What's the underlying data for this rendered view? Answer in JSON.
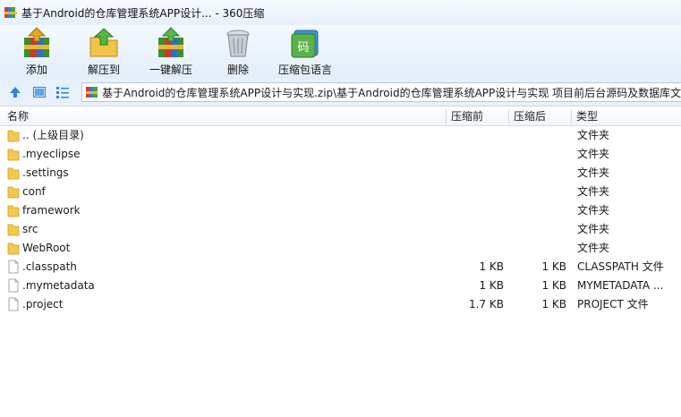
{
  "window": {
    "title": "基于Android的仓库管理系统APP设计... - 360压缩"
  },
  "toolbar": {
    "buttons": [
      {
        "label": "添加",
        "icon": "add-archive-icon"
      },
      {
        "label": "解压到",
        "icon": "extract-to-icon"
      },
      {
        "label": "一键解压",
        "icon": "one-click-extract-icon"
      },
      {
        "label": "删除",
        "icon": "delete-icon"
      },
      {
        "label": "压缩包语言",
        "icon": "archive-language-icon"
      }
    ]
  },
  "address": {
    "path": "基于Android的仓库管理系统APP设计与实现.zip\\基于Android的仓库管理系统APP设计与实现 项目前后台源码及数据库文"
  },
  "columns": {
    "name": "名称",
    "original_size": "压缩前",
    "compressed_size": "压缩后",
    "type": "类型"
  },
  "files": [
    {
      "name": ".. (上级目录)",
      "original": "",
      "compressed": "",
      "type": "文件夹",
      "kind": "folder"
    },
    {
      "name": ".myeclipse",
      "original": "",
      "compressed": "",
      "type": "文件夹",
      "kind": "folder"
    },
    {
      "name": ".settings",
      "original": "",
      "compressed": "",
      "type": "文件夹",
      "kind": "folder"
    },
    {
      "name": "conf",
      "original": "",
      "compressed": "",
      "type": "文件夹",
      "kind": "folder"
    },
    {
      "name": "framework",
      "original": "",
      "compressed": "",
      "type": "文件夹",
      "kind": "folder"
    },
    {
      "name": "src",
      "original": "",
      "compressed": "",
      "type": "文件夹",
      "kind": "folder"
    },
    {
      "name": "WebRoot",
      "original": "",
      "compressed": "",
      "type": "文件夹",
      "kind": "folder"
    },
    {
      "name": ".classpath",
      "original": "1 KB",
      "compressed": "1 KB",
      "type": "CLASSPATH 文件",
      "kind": "file"
    },
    {
      "name": ".mymetadata",
      "original": "1 KB",
      "compressed": "1 KB",
      "type": "MYMETADATA ...",
      "kind": "file"
    },
    {
      "name": ".project",
      "original": "1.7 KB",
      "compressed": "1 KB",
      "type": "PROJECT 文件",
      "kind": "file"
    }
  ]
}
